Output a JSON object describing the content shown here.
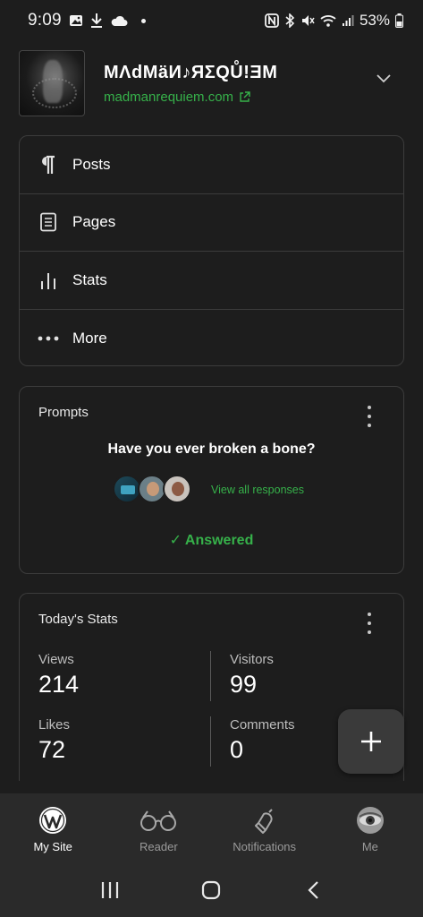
{
  "status_bar": {
    "time": "9:09",
    "battery": "53%"
  },
  "site": {
    "title": "MΛdMäИ♪ЯΣQŮ!ƎM",
    "url": "madmanrequiem.com"
  },
  "menu": {
    "items": [
      {
        "label": "Posts",
        "icon": "paragraph-icon"
      },
      {
        "label": "Pages",
        "icon": "page-icon"
      },
      {
        "label": "Stats",
        "icon": "bar-chart-icon"
      },
      {
        "label": "More",
        "icon": "ellipsis-icon"
      }
    ]
  },
  "prompts": {
    "title": "Prompts",
    "question": "Have you ever broken a bone?",
    "view_all": "View all responses",
    "answered": "✓ Answered"
  },
  "stats": {
    "title": "Today's Stats",
    "views_label": "Views",
    "views_value": "214",
    "visitors_label": "Visitors",
    "visitors_value": "99",
    "likes_label": "Likes",
    "likes_value": "72",
    "comments_label": "Comments",
    "comments_value": "0"
  },
  "bottom_nav": {
    "my_site": "My Site",
    "reader": "Reader",
    "notifications": "Notifications",
    "me": "Me"
  },
  "colors": {
    "accent_green": "#36b14a",
    "background": "#1d1d1d",
    "border": "#3c3c3c"
  }
}
